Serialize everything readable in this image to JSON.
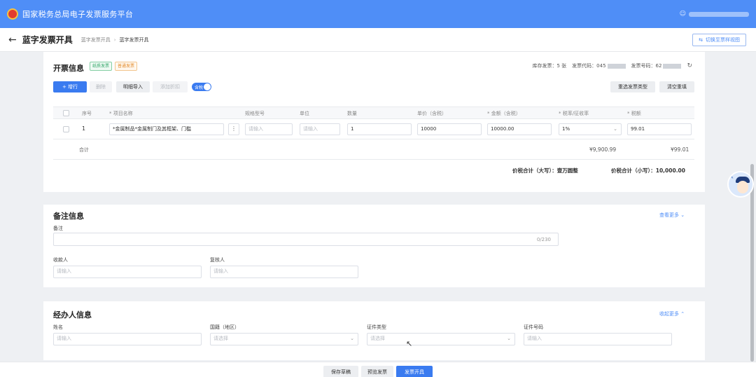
{
  "header": {
    "platform_title": "国家税务总局电子发票服务平台",
    "user_icon": "user-icon"
  },
  "subheader": {
    "back_icon": "←",
    "page_title": "蓝字发票开具",
    "breadcrumb": [
      "蓝字发票开具",
      "蓝字发票开具"
    ],
    "switch_view": "切换至票样视图"
  },
  "invoice": {
    "section_title": "开票信息",
    "tags": [
      "纸质发票",
      "普通发票"
    ],
    "stock": "库存发票：5 张",
    "code_label": "发票代码：045",
    "number_label": "发票号码：62",
    "toolbar": {
      "add_row": "+ 增行",
      "delete": "删除",
      "detail_import": "明细导入",
      "add_discount": "添加折扣",
      "tax_included": "含税",
      "reselect_type": "重选发票类型",
      "clear_refill": "清空重填"
    },
    "columns": [
      "序号",
      "* 项目名称",
      "规格型号",
      "单位",
      "数量",
      "单价（含税）",
      "* 金额（含税）",
      "* 税率/征收率",
      "* 税额"
    ],
    "rows": [
      {
        "seq": "1",
        "item_name": "*金属制品*金属制门及其框架、门槛",
        "spec_placeholder": "请输入",
        "unit_placeholder": "请输入",
        "quantity": "1",
        "unit_price": "10000",
        "amount": "10000.00",
        "tax_rate": "1%",
        "tax": "99.01"
      }
    ],
    "sum_label": "合计",
    "sum_amount": "¥9,900.99",
    "sum_tax": "¥99.01",
    "total_upper_label": "价税合计（大写）：",
    "total_upper": "壹万圆整",
    "total_lower_label": "价税合计（小写）：",
    "total_lower": "10,000.00"
  },
  "remarks": {
    "section_title": "备注信息",
    "more": "查看更多",
    "remark_label": "备注",
    "counter": "0/230",
    "payee_label": "收款人",
    "payee_placeholder": "请输入",
    "reviewer_label": "复核人",
    "reviewer_placeholder": "请输入"
  },
  "handler": {
    "section_title": "经办人信息",
    "collapse": "收起更多",
    "name_label": "姓名",
    "name_placeholder": "请输入",
    "nationality_label": "国籍（地区）",
    "nationality_placeholder": "请选择",
    "id_type_label": "证件类型",
    "id_type_placeholder": "请选择",
    "id_number_label": "证件号码",
    "id_number_placeholder": "请输入"
  },
  "footer": {
    "save_draft": "保存草稿",
    "preview": "预览发票",
    "issue": "发票开具"
  },
  "colors": {
    "header_bg": "#4f8ef7",
    "primary": "#3a7bf0"
  }
}
